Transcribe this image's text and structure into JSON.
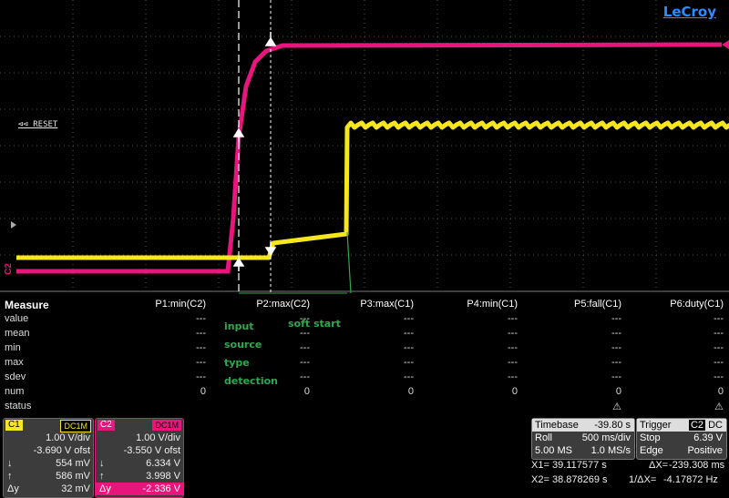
{
  "brand": "LeCroy",
  "screen": {
    "reset_label": "⊲⊲ RESET",
    "c2_marker": "C2"
  },
  "annotations": {
    "input": "input",
    "source": "source",
    "type": "type",
    "detection": "detection",
    "soft_start": "soft start"
  },
  "measure": {
    "title": "Measure",
    "columns": [
      "P1:min(C2)",
      "P2:max(C2)",
      "P3:max(C1)",
      "P4:min(C1)",
      "P5:fall(C1)",
      "P6:duty(C1)"
    ],
    "rows": [
      {
        "label": "value",
        "cells": [
          "---",
          "---",
          "---",
          "---",
          "---",
          "---"
        ]
      },
      {
        "label": "mean",
        "cells": [
          "---",
          "---",
          "---",
          "---",
          "---",
          "---"
        ]
      },
      {
        "label": "min",
        "cells": [
          "---",
          "---",
          "---",
          "---",
          "---",
          "---"
        ]
      },
      {
        "label": "max",
        "cells": [
          "---",
          "---",
          "---",
          "---",
          "---",
          "---"
        ]
      },
      {
        "label": "sdev",
        "cells": [
          "---",
          "---",
          "---",
          "---",
          "---",
          "---"
        ]
      },
      {
        "label": "num",
        "cells": [
          "0",
          "0",
          "0",
          "0",
          "0",
          "0"
        ]
      },
      {
        "label": "status",
        "cells": [
          "",
          "",
          "",
          "",
          "⚠",
          "⚠"
        ]
      }
    ]
  },
  "c1": {
    "tag": "C1",
    "coupling": "DC1M",
    "vdiv": "1.00 V/div",
    "offset": "-3.690 V ofst",
    "down": "554 mV",
    "up": "586 mV",
    "dy": "32 mV",
    "color": "#f5e61f"
  },
  "c2": {
    "tag": "C2",
    "coupling": "DC1M",
    "vdiv": "1.00 V/div",
    "offset": "-3.550 V ofst",
    "down": "6.334 V",
    "up": "3.998 V",
    "dy": "-2.336 V",
    "color": "#e8167c"
  },
  "timebase": {
    "label": "Timebase",
    "delay": "-39.80 s",
    "mode": "Roll",
    "tdiv": "500 ms/div",
    "samples": "5.00 MS",
    "rate": "1.0 MS/s"
  },
  "trigger": {
    "label": "Trigger",
    "source": "C2",
    "coupling": "DC",
    "mode": "Stop",
    "level": "6.39 V",
    "type": "Edge",
    "slope": "Positive"
  },
  "cursors": {
    "x1_label": "X1=",
    "x1": "39.117577 s",
    "x2_label": "X2=",
    "x2": "38.878269 s",
    "dx_label": "ΔX=",
    "dx": "-239.308 ms",
    "inv_label": "1/ΔX=",
    "inv": "-4.17872 Hz"
  }
}
